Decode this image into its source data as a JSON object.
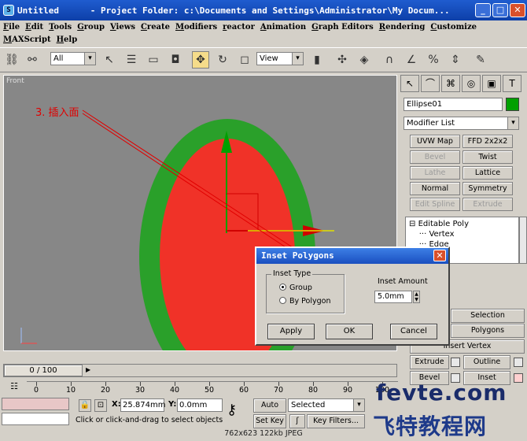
{
  "window": {
    "title": "Untitled      - Project Folder: c:\\Documents and Settings\\Administrator\\My Docum...",
    "minimize": "_",
    "maximize": "□",
    "close": "✕"
  },
  "menu": [
    "File",
    "Edit",
    "Tools",
    "Group",
    "Views",
    "Create",
    "Modifiers",
    "reactor",
    "Animation",
    "Graph Editors",
    "Rendering",
    "Customize",
    "MAXScript",
    "Help"
  ],
  "toolbar": {
    "selection_filter": "All",
    "reference_coord": "View"
  },
  "viewport": {
    "label": "Front",
    "annotation": "3. 插入面",
    "colors": {
      "background": "#878787",
      "outer": "#2aa02a",
      "inner": "#f03228",
      "gizmo_x": "#d00000",
      "gizmo_y": "#00a000"
    }
  },
  "command_panel": {
    "object_name": "Ellipse01",
    "modifier_list": "Modifier List",
    "modifier_buttons": [
      {
        "label": "UVW Map",
        "enabled": true
      },
      {
        "label": "FFD 2x2x2",
        "enabled": true
      },
      {
        "label": "Bevel",
        "enabled": false
      },
      {
        "label": "Twist",
        "enabled": true
      },
      {
        "label": "Lathe",
        "enabled": false
      },
      {
        "label": "Lattice",
        "enabled": true
      },
      {
        "label": "Normal",
        "enabled": true
      },
      {
        "label": "Symmetry",
        "enabled": true
      },
      {
        "label": "Edit Spline",
        "enabled": false
      },
      {
        "label": "Extrude",
        "enabled": false
      }
    ],
    "stack": [
      "Editable Poly",
      "Vertex",
      "Edge"
    ],
    "rollout_buttons": {
      "selection": "Selection",
      "polygons": "Polygons",
      "insert_vertex": "Insert Vertex",
      "extrude": "Extrude",
      "outline": "Outline",
      "bevel": "Bevel",
      "inset": "Inset"
    }
  },
  "dialog": {
    "title": "Inset Polygons",
    "close": "✕",
    "group_title": "Inset Type",
    "options": [
      "Group",
      "By Polygon"
    ],
    "selected_option": "Group",
    "inset_amount_label": "Inset Amount",
    "inset_amount_value": "5.0mm",
    "buttons": {
      "apply": "Apply",
      "ok": "OK",
      "cancel": "Cancel"
    }
  },
  "timeline": {
    "frame": "0 / 100",
    "ticks": [
      "0",
      "10",
      "20",
      "30",
      "40",
      "50",
      "60",
      "70",
      "80",
      "90",
      "100"
    ]
  },
  "status": {
    "x_label": "X:",
    "x_value": "25.874mm",
    "y_label": "Y:",
    "y_value": "0.0mm",
    "prompt": "Click or click-and-drag to select objects",
    "auto_key": "Auto Key",
    "set_key": "Set Key",
    "key_mode": "Selected",
    "key_filters": "Key Filters..."
  },
  "footer": "762x623  122kb  JPEG",
  "watermark": {
    "line1": "fevte.com",
    "line2": "飞特教程网"
  }
}
